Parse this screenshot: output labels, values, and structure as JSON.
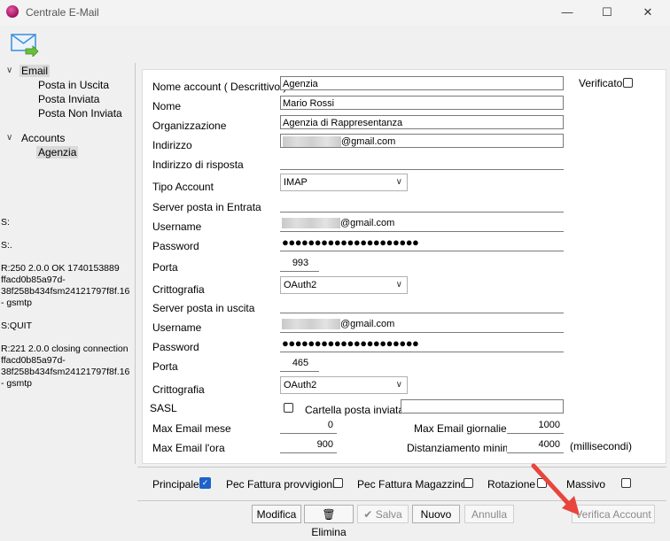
{
  "window": {
    "title": "Centrale E-Mail",
    "minimize": "—",
    "maximize": "☐",
    "close": "✕"
  },
  "tree": {
    "email": "Email",
    "posta_in_uscita": "Posta in Uscita",
    "posta_inviata": "Posta Inviata",
    "posta_non_inviata": "Posta Non Inviata",
    "accounts": "Accounts",
    "agenzia": "Agenzia"
  },
  "log": [
    "S:",
    "S:.",
    "R:250 2.0.0 OK  1740153889 ffacd0b85a97d-38f258b434fsm24121797f8f.16 - gsmtp",
    "S:QUIT",
    "R:221 2.0.0 closing connection ffacd0b85a97d-38f258b434fsm24121797f8f.16 - gsmtp"
  ],
  "form": {
    "nome_account_label": "Nome account ( Descrittivo )",
    "nome_account_value": "Agenzia",
    "verificato_label": "Verificato",
    "nome_label": "Nome",
    "nome_value": "Mario Rossi",
    "organizzazione_label": "Organizzazione",
    "organizzazione_value": "Agenzia di Rappresentanza",
    "indirizzo_label": "Indirizzo",
    "indirizzo_suffix": "@gmail.com",
    "indirizzo_risposta_label": "Indirizzo di risposta",
    "tipo_account_label": "Tipo Account",
    "tipo_account_value": "IMAP",
    "server_entrata_label": "Server posta in Entrata",
    "username_in_label": "Username",
    "username_in_suffix": "@gmail.com",
    "password_in_label": "Password",
    "password_in_value": "●●●●●●●●●●●●●●●●●●●●●",
    "porta_in_label": "Porta",
    "porta_in_value": "993",
    "crittografia_in_label": "Crittografia",
    "crittografia_in_value": "OAuth2",
    "server_uscita_label": "Server posta in uscita",
    "username_out_label": "Username",
    "username_out_suffix": "@gmail.com",
    "password_out_label": "Password",
    "password_out_value": "●●●●●●●●●●●●●●●●●●●●●",
    "porta_out_label": "Porta",
    "porta_out_value": "465",
    "crittografia_out_label": "Crittografia",
    "crittografia_out_value": "OAuth2",
    "sasl_label": "SASL",
    "cartella_label": "Cartella posta inviata",
    "max_mese_label": "Max Email mese",
    "max_mese_value": "0",
    "max_giornaliere_label": "Max Email giornaliere",
    "max_giornaliere_value": "1000",
    "max_ora_label": "Max Email l'ora",
    "max_ora_value": "900",
    "distanziamento_label": "Distanziamento minimo",
    "distanziamento_value": "4000",
    "millisecondi_label": "(millisecondi)"
  },
  "options": {
    "principale": "Principale",
    "pec_provvigioni": "Pec Fattura provvigioni",
    "pec_magazzino": "Pec Fattura Magazzino",
    "rotazione": "Rotazione",
    "massivo": "Massivo"
  },
  "buttons": {
    "modifica": "Modifica",
    "elimina": "Elimina",
    "salva": "Salva",
    "nuovo": "Nuovo",
    "annulla": "Annulla",
    "verifica": "Verifica Account"
  },
  "colors": {
    "accent": "#1d63c9",
    "annotation_arrow": "#e8453c"
  }
}
